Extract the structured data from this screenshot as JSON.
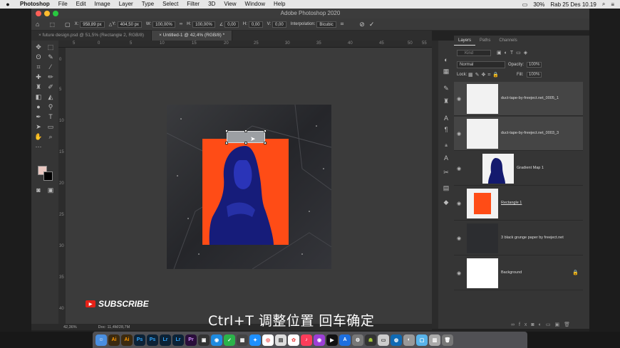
{
  "menubar": {
    "app_name": "Photoshop",
    "items": [
      "File",
      "Edit",
      "Image",
      "Layer",
      "Type",
      "Select",
      "Filter",
      "3D",
      "View",
      "Window",
      "Help"
    ],
    "battery": "30%",
    "clock": "Rab 25 Des 10.19"
  },
  "window": {
    "title": "Adobe Photoshop 2020"
  },
  "options_bar": {
    "x_label": "X:",
    "x_value": "958,89 px",
    "y_label": "Y:",
    "y_value": "404,50 px",
    "w_label": "W:",
    "w_value": "100,00%",
    "h_label": "H:",
    "h_value": "100,00%",
    "angle_value": "0,00",
    "hskew_label": "H:",
    "hskew_value": "0,00",
    "vskew_label": "V:",
    "vskew_value": "0,00",
    "interp_label": "Interpolation:",
    "interp_value": "Bicubic"
  },
  "tabs": [
    {
      "label": "future design.psd @ 51,5% (Rectangle 2, RGB/8)"
    },
    {
      "label": "Untitled-1 @ 42,4% (RGB/8) *"
    }
  ],
  "ruler_h": [
    "5",
    "0",
    "5",
    "10",
    "15",
    "20",
    "25",
    "30",
    "35",
    "40",
    "45",
    "50",
    "55"
  ],
  "ruler_v": [
    "0",
    "5",
    "10",
    "15",
    "20",
    "25",
    "30",
    "35",
    "40"
  ],
  "status": {
    "zoom": "42,36%",
    "doc": "Doc: 11,4M/28,7M"
  },
  "layers_panel": {
    "tabs": [
      "Layers",
      "Paths",
      "Channels"
    ],
    "kind_placeholder": "Kind",
    "blend_mode": "Normal",
    "opacity_label": "Opacity:",
    "opacity_value": "100%",
    "lock_label": "Lock:",
    "fill_label": "Fill:",
    "fill_value": "100%",
    "layers": [
      {
        "name": "duct-tape-by-freeject.net_0005_1"
      },
      {
        "name": "duct-tape-by-freeject.net_0003_3"
      },
      {
        "name": "Gradient Map 1"
      },
      {
        "name": "Rectangle 1"
      },
      {
        "name": "3 black grunge paper by freeject.net"
      },
      {
        "name": "Background"
      }
    ]
  },
  "overlay": {
    "subscribe": "SUBSCRIBE",
    "caption": "Ctrl+T 调整位置 回车确定"
  },
  "dock": {
    "apps": [
      "Ai",
      "Ai",
      "Ps",
      "Ps",
      "Lr",
      "Lr",
      "Pr"
    ]
  },
  "colors": {
    "accent_orange": "#ff4c16",
    "figure_blue": "#1a1f8a",
    "foreground_swatch": "#e9c7c0"
  }
}
